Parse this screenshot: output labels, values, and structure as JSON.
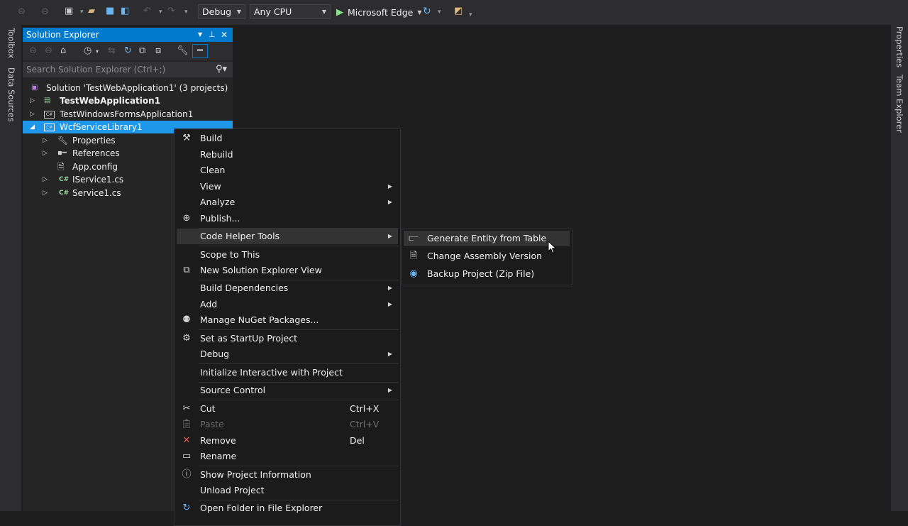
{
  "toolbar": {
    "configuration": "Debug",
    "platform": "Any CPU",
    "run_target": "Microsoft Edge",
    "icons": [
      "back-icon",
      "forward-icon",
      "new-project-icon",
      "open-folder-icon",
      "save-icon",
      "save-all-icon",
      "undo-icon",
      "redo-icon",
      "refresh-icon",
      "browser-link-icon"
    ]
  },
  "left_strip": {
    "tabs": [
      "Toolbox",
      "Data Sources"
    ]
  },
  "right_strip": {
    "tabs": [
      "Properties",
      "Team Explorer"
    ]
  },
  "solution_explorer": {
    "title": "Solution Explorer",
    "search_placeholder": "Search Solution Explorer (Ctrl+;)",
    "tree": [
      {
        "label": "Solution 'TestWebApplication1' (3 projects)",
        "icon": "solution-icon"
      },
      {
        "label": "TestWebApplication1",
        "icon": "web-project-icon",
        "bold": true
      },
      {
        "label": "TestWindowsFormsApplication1",
        "icon": "csharp-project-icon"
      },
      {
        "label": "WcfServiceLibrary1",
        "icon": "csharp-project-icon",
        "selected": true
      },
      {
        "label": "Properties",
        "icon": "wrench-icon"
      },
      {
        "label": "References",
        "icon": "references-icon"
      },
      {
        "label": "App.config",
        "icon": "config-file-icon"
      },
      {
        "label": "IService1.cs",
        "icon": "csharp-file-icon"
      },
      {
        "label": "Service1.cs",
        "icon": "csharp-file-icon"
      }
    ]
  },
  "context_menu": {
    "items": [
      {
        "label": "Build",
        "icon": "build-icon"
      },
      {
        "label": "Rebuild"
      },
      {
        "label": "Clean"
      },
      {
        "label": "View",
        "submenu": true
      },
      {
        "label": "Analyze",
        "submenu": true
      },
      {
        "label": "Publish...",
        "icon": "globe-icon"
      },
      {
        "label": "Code Helper Tools",
        "submenu": true,
        "highlighted": true
      },
      {
        "label": "Scope to This"
      },
      {
        "label": "New Solution Explorer View",
        "icon": "new-view-icon"
      },
      {
        "label": "Build Dependencies",
        "submenu": true
      },
      {
        "label": "Add",
        "submenu": true
      },
      {
        "label": "Manage NuGet Packages...",
        "icon": "nuget-icon"
      },
      {
        "label": "Set as StartUp Project",
        "icon": "gear-icon"
      },
      {
        "label": "Debug",
        "submenu": true
      },
      {
        "label": "Initialize Interactive with Project"
      },
      {
        "label": "Source Control",
        "submenu": true
      },
      {
        "label": "Cut",
        "icon": "scissors-icon",
        "shortcut": "Ctrl+X"
      },
      {
        "label": "Paste",
        "icon": "paste-icon",
        "shortcut": "Ctrl+V",
        "disabled": true
      },
      {
        "label": "Remove",
        "icon": "remove-icon",
        "shortcut": "Del"
      },
      {
        "label": "Rename",
        "icon": "rename-icon"
      },
      {
        "label": "Show Project Information",
        "icon": "info-icon"
      },
      {
        "label": "Unload Project"
      },
      {
        "label": "Open Folder in File Explorer",
        "icon": "open-folder-refresh-icon"
      }
    ]
  },
  "submenu": {
    "items": [
      {
        "label": "Generate Entity from Table",
        "icon": "entity-icon",
        "highlighted": true
      },
      {
        "label": "Change Assembly Version",
        "icon": "document-icon"
      },
      {
        "label": "Backup Project (Zip File)",
        "icon": "backup-icon"
      }
    ]
  },
  "colors": {
    "background": "#1e1e1e",
    "chrome": "#2d2d30",
    "accent": "#007acc",
    "selection": "#1c97ea",
    "menu_background": "#1b1b1c"
  }
}
